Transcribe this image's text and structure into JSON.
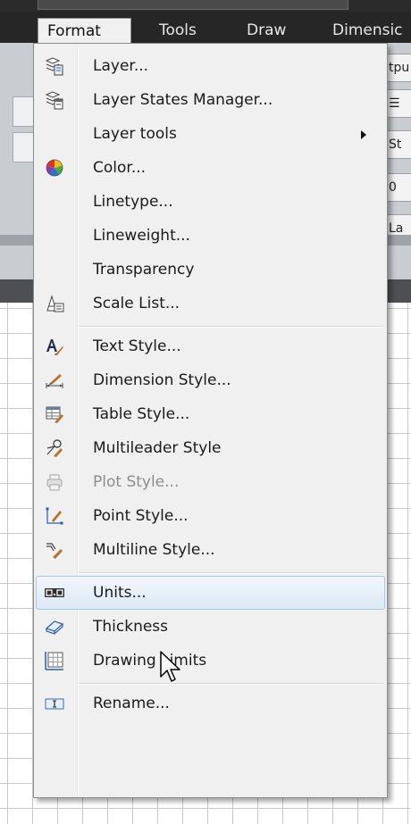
{
  "menubar": {
    "items": [
      {
        "label": "Format",
        "active": true
      },
      {
        "label": "Tools"
      },
      {
        "label": "Draw"
      },
      {
        "label": "Dimensic"
      }
    ]
  },
  "ribbon": {
    "partial_labels": [
      "tpu",
      "St",
      "0",
      "La"
    ]
  },
  "menu": {
    "items": [
      {
        "label": "Layer...",
        "icon": "layer-icon"
      },
      {
        "label": "Layer States Manager...",
        "icon": "layer-states-icon"
      },
      {
        "label": "Layer tools",
        "icon": "",
        "submenu": true
      },
      {
        "label": "Color...",
        "icon": "color-wheel-icon"
      },
      {
        "label": "Linetype...",
        "icon": ""
      },
      {
        "label": "Lineweight...",
        "icon": ""
      },
      {
        "label": "Transparency",
        "icon": ""
      },
      {
        "label": "Scale List...",
        "icon": "scale-list-icon"
      },
      {
        "label": "Text Style...",
        "icon": "text-style-icon"
      },
      {
        "label": "Dimension Style...",
        "icon": "dimension-style-icon"
      },
      {
        "label": "Table Style...",
        "icon": "table-style-icon"
      },
      {
        "label": "Multileader Style",
        "icon": "multileader-style-icon"
      },
      {
        "label": "Plot Style...",
        "icon": "plot-style-icon",
        "disabled": true
      },
      {
        "label": "Point Style...",
        "icon": "point-style-icon"
      },
      {
        "label": "Multiline Style...",
        "icon": "multiline-style-icon"
      },
      {
        "label": "Units...",
        "icon": "units-icon",
        "hover": true
      },
      {
        "label": "Thickness",
        "icon": "thickness-icon"
      },
      {
        "label": "Drawing Limits",
        "icon": "drawing-limits-icon"
      },
      {
        "label": "Rename...",
        "icon": "rename-icon"
      }
    ]
  },
  "colors": {
    "menubar_bg": "#262626",
    "menu_bg": "#f0f0f0",
    "hover_border": "#a8c8e8",
    "disabled_text": "#8d8d8d"
  }
}
